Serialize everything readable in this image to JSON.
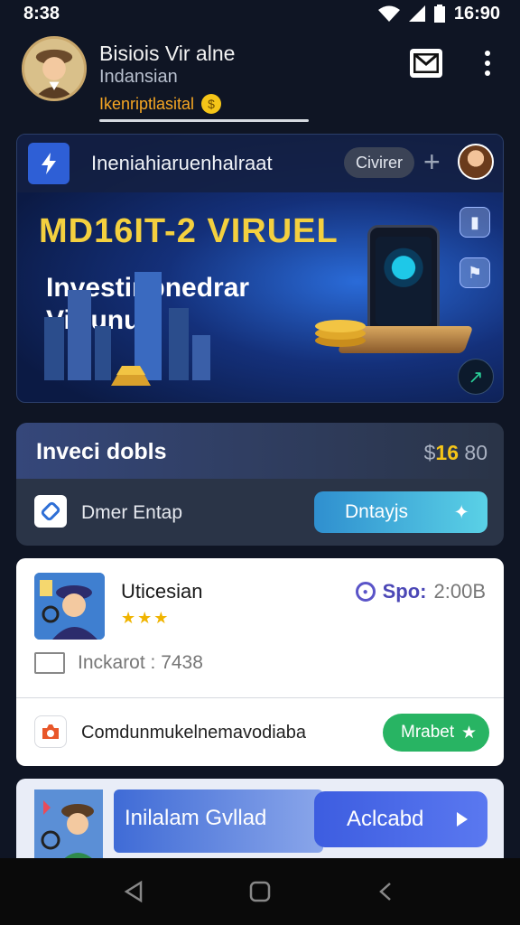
{
  "status_bar": {
    "time": "8:38",
    "right_time": "16:90"
  },
  "header": {
    "user_name": "Bisiois Vir alne",
    "user_sub": "Indansian",
    "user_badge": "Ikenriptlasital",
    "badge_coin": "$"
  },
  "banner": {
    "heading": "Ineniahiaruenhalraat",
    "pill_label": "Civirer",
    "title": "MD16IT-2 VIRUEL",
    "subtitle": "Investinpnedrar Virtunual"
  },
  "invest": {
    "title": "Inveci dobls",
    "amount_prefix": "$",
    "amount_highlight": "16",
    "amount_suffix": " 80",
    "action_label": "Dmer Entap",
    "button_label": "Dntayjs"
  },
  "user_card": {
    "name": "Uticesian",
    "stars": "★★★",
    "spo_label": "Spo:",
    "spo_value": "2:00B",
    "row_label": "Inckarot  :  7438",
    "bottom_label": "Comdunmukelnemavodiaba",
    "bottom_button": "Mrabet"
  },
  "promo": {
    "title": "Inilalam Gvllad",
    "button_label": "Aclcabd"
  },
  "colors": {
    "background": "#0f1524",
    "accent_gold": "#f5c518",
    "accent_green": "#28b463",
    "accent_blue": "#3d5de0",
    "badge_orange": "#f6a623"
  },
  "icons": {
    "wifi": "wifi-icon",
    "signal": "signal-icon",
    "battery": "battery-icon",
    "message": "message-icon",
    "more": "more-vertical-icon",
    "back": "back-icon",
    "home": "home-icon",
    "recents": "recents-icon"
  }
}
